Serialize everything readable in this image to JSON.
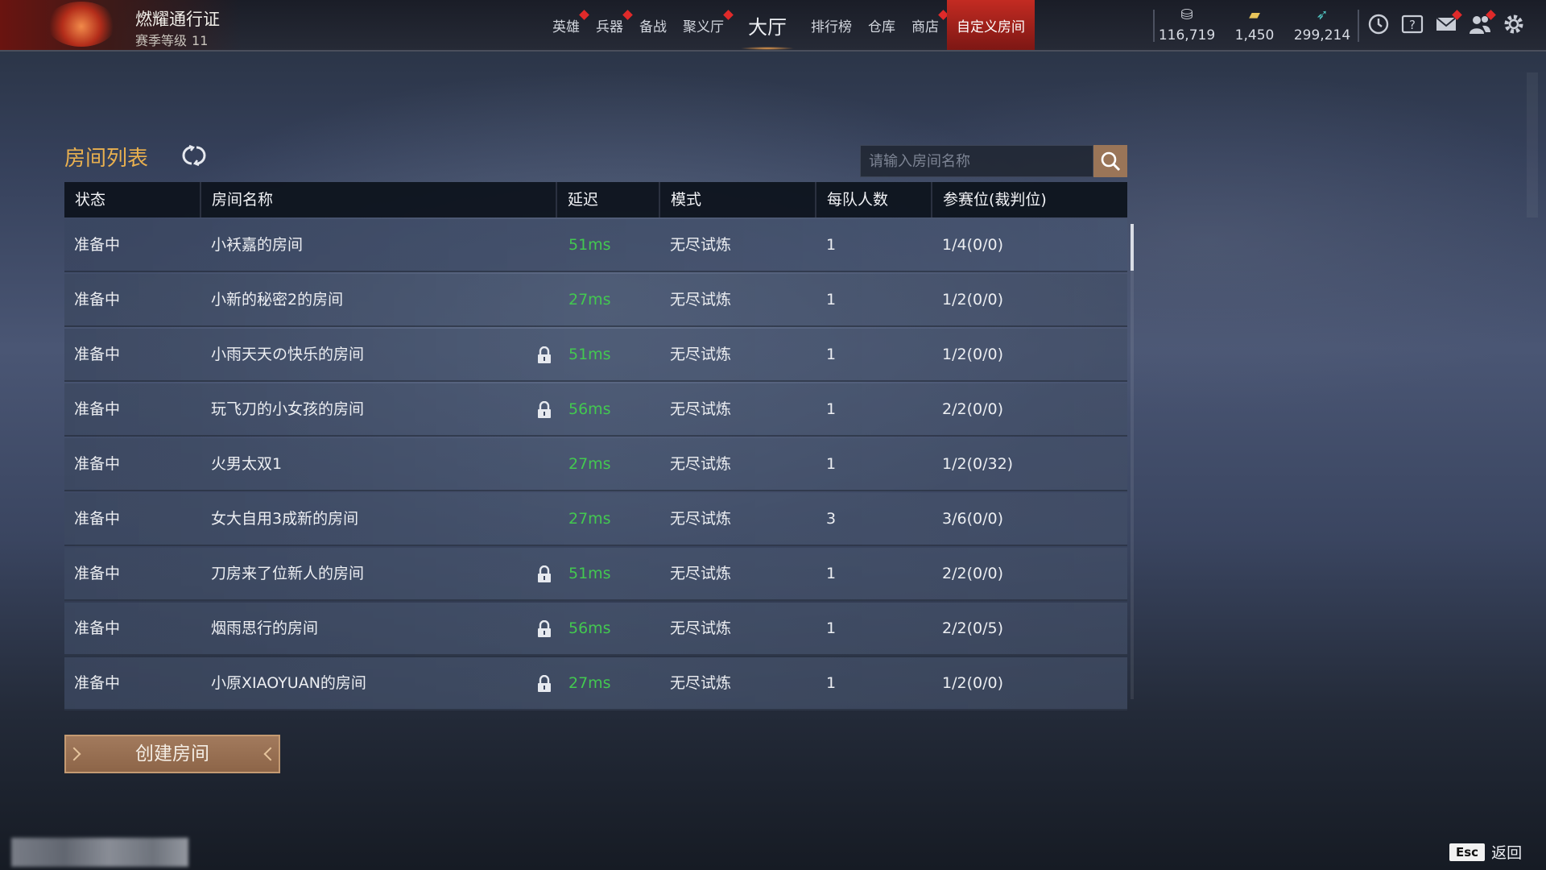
{
  "header": {
    "pass_title": "燃耀通行证",
    "season_label": "赛季等级",
    "season_level": "11"
  },
  "nav": {
    "items": [
      {
        "label": "英雄",
        "badge": true
      },
      {
        "label": "兵器",
        "badge": true
      },
      {
        "label": "备战",
        "badge": false
      },
      {
        "label": "聚义厅",
        "badge": true
      },
      {
        "label": "大厅",
        "badge": false
      },
      {
        "label": "排行榜",
        "badge": false
      },
      {
        "label": "仓库",
        "badge": false
      },
      {
        "label": "商店",
        "badge": true
      },
      {
        "label": "自定义房间",
        "badge": false
      }
    ],
    "active": "自定义房间"
  },
  "currencies": [
    {
      "icon": "coin-icon",
      "value": "116,719"
    },
    {
      "icon": "gold-ingot-icon",
      "value": "1,450"
    },
    {
      "icon": "jade-feather-icon",
      "value": "299,214"
    }
  ],
  "tools": [
    {
      "icon": "timer-icon",
      "badge": false
    },
    {
      "icon": "help-icon",
      "badge": false
    },
    {
      "icon": "mail-icon",
      "badge": true
    },
    {
      "icon": "friends-icon",
      "badge": true
    },
    {
      "icon": "settings-icon",
      "badge": false
    }
  ],
  "room_list": {
    "title": "房间列表",
    "search_placeholder": "请输入房间名称",
    "columns": [
      "状态",
      "房间名称",
      "延迟",
      "模式",
      "每队人数",
      "参赛位(裁判位)"
    ],
    "rows": [
      {
        "status": "准备中",
        "name": "小袄嘉的房间",
        "locked": false,
        "latency": "51ms",
        "mode": "无尽试炼",
        "team_size": "1",
        "slots": "1/4(0/0)"
      },
      {
        "status": "准备中",
        "name": "小新的秘密2的房间",
        "locked": false,
        "latency": "27ms",
        "mode": "无尽试炼",
        "team_size": "1",
        "slots": "1/2(0/0)"
      },
      {
        "status": "准备中",
        "name": "小雨天天の快乐的房间",
        "locked": true,
        "latency": "51ms",
        "mode": "无尽试炼",
        "team_size": "1",
        "slots": "1/2(0/0)"
      },
      {
        "status": "准备中",
        "name": "玩飞刀的小女孩的房间",
        "locked": true,
        "latency": "56ms",
        "mode": "无尽试炼",
        "team_size": "1",
        "slots": "2/2(0/0)"
      },
      {
        "status": "准备中",
        "name": "火男太双1",
        "locked": false,
        "latency": "27ms",
        "mode": "无尽试炼",
        "team_size": "1",
        "slots": "1/2(0/32)"
      },
      {
        "status": "准备中",
        "name": "女大自用3成新的房间",
        "locked": false,
        "latency": "27ms",
        "mode": "无尽试炼",
        "team_size": "3",
        "slots": "3/6(0/0)"
      },
      {
        "status": "准备中",
        "name": "刀房来了位新人的房间",
        "locked": true,
        "latency": "51ms",
        "mode": "无尽试炼",
        "team_size": "1",
        "slots": "2/2(0/0)"
      },
      {
        "status": "准备中",
        "name": "烟雨思行的房间",
        "locked": true,
        "latency": "56ms",
        "mode": "无尽试炼",
        "team_size": "1",
        "slots": "2/2(0/5)"
      },
      {
        "status": "准备中",
        "name": "小原XIAOYUAN的房间",
        "locked": true,
        "latency": "27ms",
        "mode": "无尽试炼",
        "team_size": "1",
        "slots": "1/2(0/0)"
      }
    ]
  },
  "actions": {
    "create_room": "创建房间",
    "esc_key": "Esc",
    "back": "返回"
  },
  "colors": {
    "accent_gold": "#e9b04f",
    "latency_green": "#43c850",
    "active_tab_red": "#c32b22",
    "button_brown": "#9a7558"
  }
}
